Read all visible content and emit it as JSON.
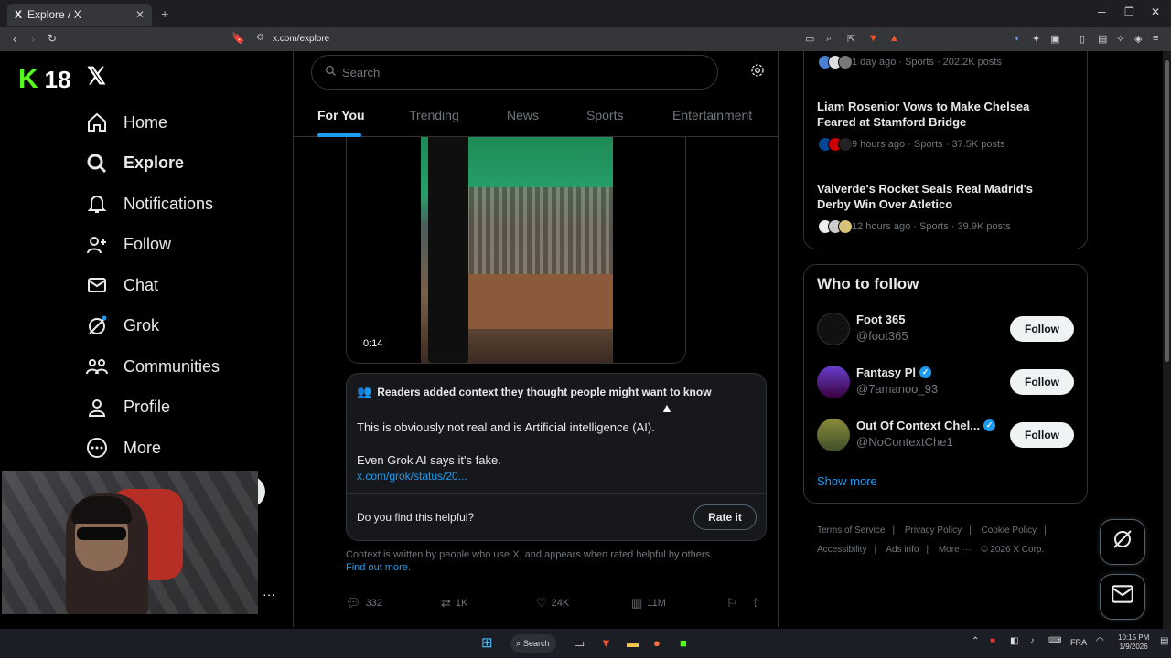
{
  "browser": {
    "tab_title": "Explore / X",
    "tab_icon": "X",
    "url": "x.com/explore"
  },
  "brand": {
    "kick_logo": "K",
    "kick_number": "18",
    "x_logo": "𝕏"
  },
  "nav": {
    "items": [
      {
        "label": "Home",
        "icon": "home-icon",
        "active": false
      },
      {
        "label": "Explore",
        "icon": "search-icon",
        "active": true
      },
      {
        "label": "Notifications",
        "icon": "bell-icon",
        "active": false
      },
      {
        "label": "Follow",
        "icon": "person-plus-icon",
        "active": false
      },
      {
        "label": "Chat",
        "icon": "mail-icon",
        "active": false
      },
      {
        "label": "Grok",
        "icon": "grok-icon",
        "active": false
      },
      {
        "label": "Communities",
        "icon": "communities-icon",
        "active": false
      },
      {
        "label": "Profile",
        "icon": "person-icon",
        "active": false
      },
      {
        "label": "More",
        "icon": "more-circle-icon",
        "active": false
      }
    ]
  },
  "search": {
    "placeholder": "Search"
  },
  "tabs": [
    "For You",
    "Trending",
    "News",
    "Sports",
    "Entertainment"
  ],
  "video": {
    "duration": "0:14"
  },
  "community_note": {
    "header": "Readers added context they thought people might want to know",
    "line1": "This is obviously not real and is Artificial intelligence (AI).",
    "line2": "Even Grok AI says it's fake.",
    "link": "x.com/grok/status/20...",
    "question": "Do you find this helpful?",
    "rate_label": "Rate it"
  },
  "context": {
    "text": "Context is written by people who use X, and appears when rated helpful by others.",
    "link": "Find out more."
  },
  "actions": {
    "replies": "332",
    "reposts": "1K",
    "likes": "24K",
    "views": "11M"
  },
  "trends": [
    {
      "title": "",
      "meta": "1 day ago · Sports · 202.2K posts"
    },
    {
      "title": "Liam Rosenior Vows to Make Chelsea Feared at Stamford Bridge",
      "meta": "9 hours ago · Sports · 37.5K posts"
    },
    {
      "title": "Valverde's Rocket Seals Real Madrid's Derby Win Over Atletico",
      "meta": "12 hours ago · Sports · 39.9K posts"
    }
  ],
  "who_to_follow": {
    "heading": "Who to follow",
    "accounts": [
      {
        "name": "Foot 365",
        "handle": "@foot365",
        "verified": false,
        "follow_label": "Follow"
      },
      {
        "name": "Fantasy Pl",
        "handle": "@7amanoo_93",
        "verified": true,
        "follow_label": "Follow"
      },
      {
        "name": "Out Of Context Chel...",
        "handle": "@NoContextChe1",
        "verified": true,
        "follow_label": "Follow"
      }
    ],
    "show_more": "Show more"
  },
  "footer": {
    "links": [
      "Terms of Service",
      "Privacy Policy",
      "Cookie Policy",
      "Accessibility",
      "Ads info",
      "More ···"
    ],
    "copyright": "© 2026 X Corp."
  },
  "taskbar": {
    "search_label": "Search",
    "lang": "FRA",
    "time": "10:15 PM",
    "date": "1/9/2026"
  },
  "colors": {
    "accent": "#1d9bf0",
    "kick_green": "#53fc18",
    "background": "#000000"
  }
}
